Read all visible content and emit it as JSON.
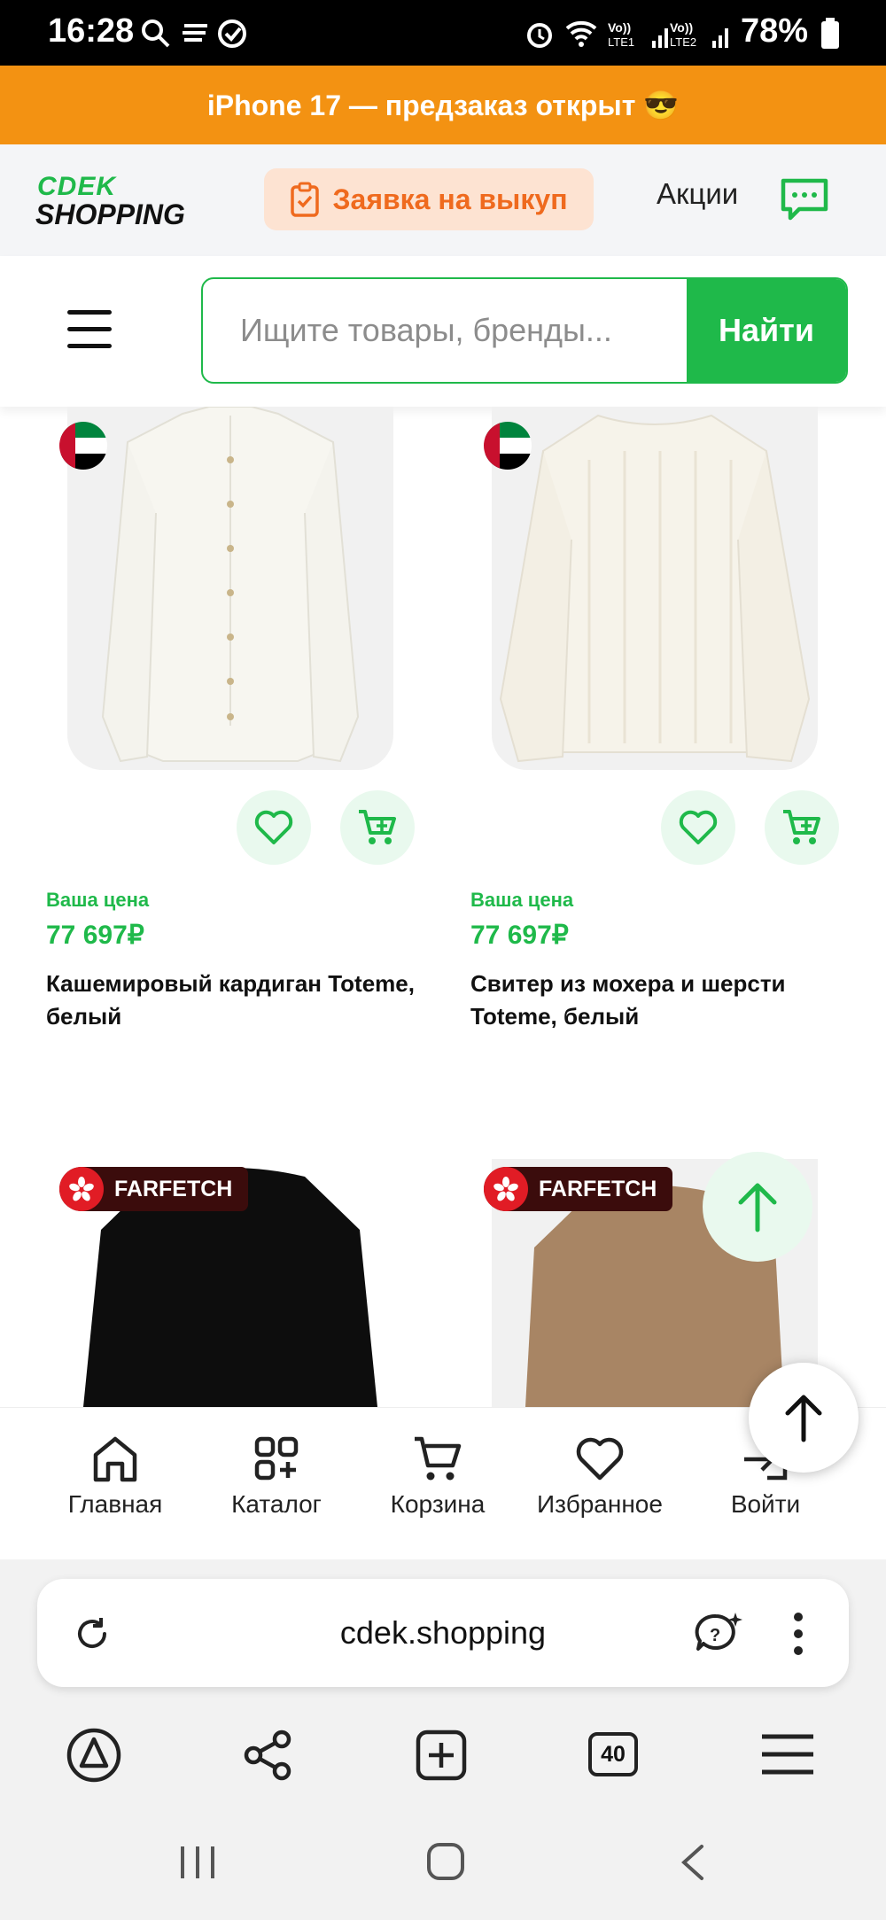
{
  "status_bar": {
    "time": "16:28",
    "battery": "78%"
  },
  "promo_banner": {
    "text": "iPhone 17 — предзаказ открыт 😎"
  },
  "header": {
    "logo_top": "CDEK",
    "logo_bottom": "SHOPPING",
    "buyout_label": "Заявка на выкуп",
    "promos_label": "Акции"
  },
  "search": {
    "placeholder": "Ищите товары, бренды...",
    "button_label": "Найти"
  },
  "products": [
    {
      "price_label": "Ваша цена",
      "price": "77 697₽",
      "name": "Кашемировый кардиган Toteme, белый"
    },
    {
      "price_label": "Ваша цена",
      "price": "77 697₽",
      "name": "Свитер из мохера и шерсти Toteme, белый"
    },
    {
      "badge": "FARFETCH"
    },
    {
      "badge": "FARFETCH"
    }
  ],
  "bottom_nav": [
    {
      "label": "Главная",
      "icon": "home-icon"
    },
    {
      "label": "Каталог",
      "icon": "catalog-icon"
    },
    {
      "label": "Корзина",
      "icon": "cart-icon"
    },
    {
      "label": "Избранное",
      "icon": "heart-icon"
    },
    {
      "label": "Войти",
      "icon": "login-icon"
    }
  ],
  "browser": {
    "url": "cdek.shopping",
    "tab_count": "40"
  },
  "colors": {
    "brand_green": "#1fb94a",
    "promo_orange": "#f39212",
    "buyout_orange": "#ef6a1e"
  }
}
